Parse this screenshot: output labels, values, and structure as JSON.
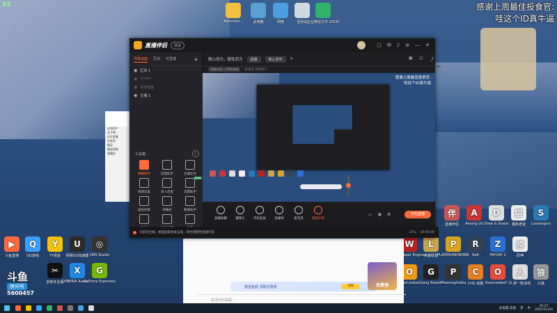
{
  "frame_counter": "32",
  "thanks": {
    "line1": "感谢上周最佳投食官:",
    "line2": "哇这个ID真牛逼"
  },
  "desktop_top_icons": [
    {
      "label": "Administr...",
      "color": "#f0c040"
    },
    {
      "label": "此电脑",
      "color": "#5a9fd4"
    },
    {
      "label": "网络",
      "color": "#4aa0e0"
    },
    {
      "label": "回收站",
      "color": "#d0d8e0"
    },
    {
      "label": "企业微信文件 20190510...",
      "color": "#2fb36a"
    }
  ],
  "desktop_left_icons": [
    {
      "label": "斗鱼直播",
      "color": "#ff6a3c",
      "glyph": "▶"
    },
    {
      "label": "QQ游戏",
      "color": "#3aa0ff",
      "glyph": "Q"
    },
    {
      "label": "YY语音",
      "color": "#f5c400",
      "glyph": "Y"
    },
    {
      "label": "网易UU加速器",
      "color": "#2b2b2b",
      "glyph": "U"
    },
    {
      "label": "OBS Studio",
      "color": "#333",
      "glyph": "◎"
    },
    {
      "label": "剪映专业版",
      "color": "#111",
      "glyph": "✂"
    },
    {
      "label": "XIBERIA Audio...",
      "color": "#1e88e5",
      "glyph": "X"
    },
    {
      "label": "GeForce Experience",
      "color": "#76b900",
      "glyph": "G"
    }
  ],
  "desktop_right_icons": [
    {
      "label": "直播伴侣",
      "color": "#c55",
      "glyph": "伴"
    },
    {
      "label": "Among Us",
      "color": "#c33",
      "glyph": "A"
    },
    {
      "label": "Draw & Guess",
      "color": "#ddd",
      "glyph": "D"
    },
    {
      "label": "猫和老鼠",
      "color": "#eee",
      "glyph": "猫"
    },
    {
      "label": "Lossengers",
      "color": "#2a7ab5",
      "glyph": "S"
    },
    {
      "label": "Wallpaper Engine",
      "color": "#b22",
      "glyph": "W"
    },
    {
      "label": "英雄联盟",
      "color": "#c9a44b",
      "glyph": "L"
    },
    {
      "label": "PLAYERUNKNOWN'S BATTLEGROUNDS",
      "color": "#d9a520",
      "glyph": "P"
    },
    {
      "label": "Raft",
      "color": "#345",
      "glyph": "R"
    },
    {
      "label": "PAYDAY 2",
      "color": "#2a6fd6",
      "glyph": "Z"
    },
    {
      "label": "原神",
      "color": "#eee",
      "glyph": "原"
    },
    {
      "label": "Overcooked",
      "color": "#f39c12",
      "glyph": "O"
    },
    {
      "label": "Gang Beasts",
      "color": "#222",
      "glyph": "G"
    },
    {
      "label": "Phasmophobia",
      "color": "#333",
      "glyph": "P"
    },
    {
      "label": "CHO 逃脱",
      "color": "#e67e22",
      "glyph": "C"
    },
    {
      "label": "Overcooked! 2",
      "color": "#e74c3c",
      "glyph": "O"
    },
    {
      "label": "人类一败涂地",
      "color": "#ddd",
      "glyph": "人"
    },
    {
      "label": "只狼",
      "color": "#999",
      "glyph": "狼"
    }
  ],
  "app": {
    "title": "直播伴侣",
    "beta": "测试",
    "left_tabs": [
      "场景画面",
      "互动",
      "可直播",
      "+"
    ],
    "scenes": [
      {
        "name": "区块 1",
        "dim": false
      },
      {
        "name": "Scene",
        "dim": true
      },
      {
        "name": "场景画面",
        "dim": true
      },
      {
        "name": "主播 1",
        "dim": false
      }
    ],
    "tools_title": "工具箱",
    "tools": [
      {
        "label": "弹幕助手",
        "badge": "",
        "red": true
      },
      {
        "label": "房管助手",
        "badge": "",
        "red": false
      },
      {
        "label": "主播任务",
        "badge": "",
        "red": false
      },
      {
        "label": "视频连麦",
        "badge": "",
        "red": false
      },
      {
        "label": "多人连麦",
        "badge": "",
        "red": false
      },
      {
        "label": "流量助手",
        "badge": "NEW",
        "red": false
      },
      {
        "label": "虚拟形象",
        "badge": "",
        "red": false
      },
      {
        "label": "弹幕屏",
        "badge": "",
        "red": false
      },
      {
        "label": "数据助手",
        "badge": "",
        "red": false
      },
      {
        "label": "更多",
        "badge": "",
        "red": false
      },
      {
        "label": "直播设置",
        "badge": "",
        "red": false
      },
      {
        "label": "观看",
        "badge": "",
        "red": false
      }
    ],
    "topbar": {
      "title1": "随心而为，随性而为",
      "chip": "直播",
      "chip2": "随心发布"
    },
    "info": {
      "status": "直播分区 | 游戏直播",
      "room": "房间号 500457"
    },
    "controls": [
      {
        "label": "直播屏幕",
        "red": false
      },
      {
        "label": "摄像头",
        "red": false
      },
      {
        "label": "手机投屏",
        "red": false
      },
      {
        "label": "多媒体",
        "red": false
      },
      {
        "label": "麦克风",
        "red": false
      },
      {
        "label": "系统声音",
        "red": true
      }
    ],
    "start_button": "开始直播",
    "status_text": "亲爱的主播，根据国家相关法规，请合理使用直播内容",
    "status_time": "00:00:00",
    "status_net": "25%"
  },
  "chat": {
    "lines": [
      "在线用户",
      "木子鸭",
      "LOL直播",
      "木鱼死",
      "精灵",
      "精彩视频",
      "我最好"
    ],
    "input_placeholder": "发送你的弹幕...",
    "banner_text": "赠送鱼翅 领取优惠券",
    "banner_btn": "领取",
    "ad_label": "免费领"
  },
  "douyu": {
    "logo": "斗鱼",
    "room_label": "房间号",
    "room_id": "5600457"
  },
  "taskbar": {
    "time": "20:27",
    "date": "2021/11/24",
    "tray": [
      "英",
      "中"
    ],
    "tray_text": "此电脑 高速",
    "icon_colors": [
      "#ff6a3c",
      "#f5c400",
      "#3aa0ff",
      "#2fb36a",
      "#c55",
      "#777",
      "#4aa0e0",
      "#ddd"
    ]
  }
}
